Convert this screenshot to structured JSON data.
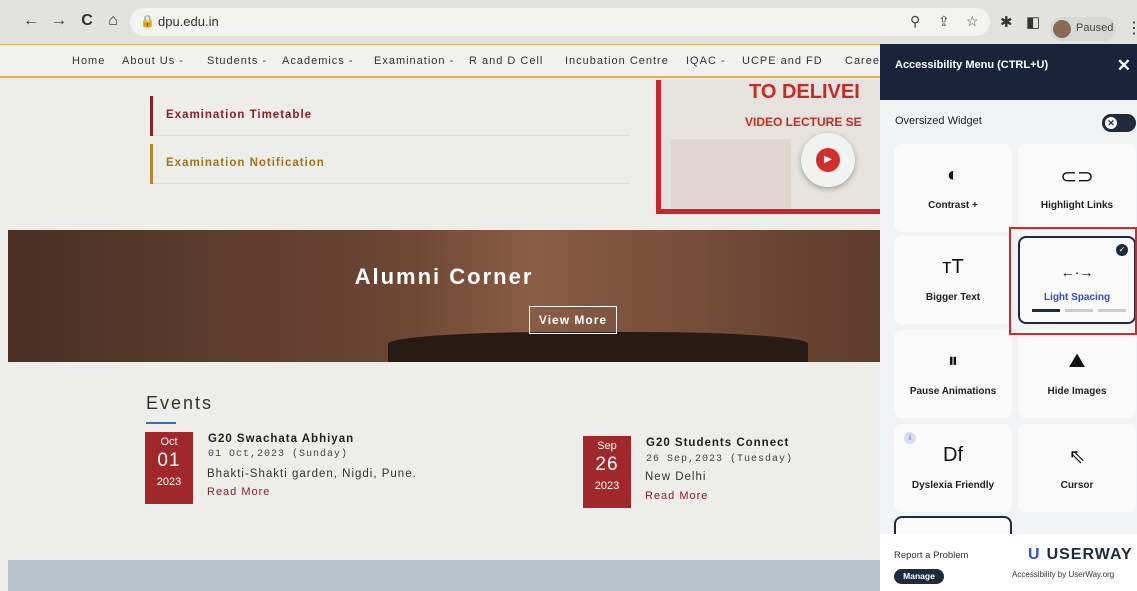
{
  "browser": {
    "url": "dpu.edu.in",
    "profile_status": "Paused",
    "icons": [
      "back-icon",
      "forward-icon",
      "reload-icon",
      "home-icon",
      "lock-icon",
      "search-icon",
      "share-icon",
      "star-icon",
      "extensions-icon",
      "sidepanel-icon",
      "kebab-icon"
    ],
    "back_glyph": "←",
    "forward_glyph": "→",
    "reload_glyph": "C",
    "home_glyph": "⌂",
    "lock_glyph": "🔒",
    "zoom_glyph": "⚲",
    "share_glyph": "⇪",
    "star_glyph": "☆",
    "ext_glyph": "✱",
    "panel_glyph": "◧",
    "kebab_glyph": "⋮"
  },
  "nav": {
    "items": [
      "Home",
      "About Us -",
      "Students -",
      "Academics -",
      "Examination -",
      "R and D Cell",
      "Incubation Centre",
      "IQAC -",
      "UCPE and FD",
      "Caree"
    ]
  },
  "exam_links": [
    {
      "label": "Examination Timetable",
      "color": "#8c1f23"
    },
    {
      "label": "Examination Notification",
      "color": "#a37418"
    }
  ],
  "video": {
    "line1": "TO DELIVEI",
    "line2": "VIDEO LECTURE SE",
    "play_glyph": "▶"
  },
  "alumni": {
    "title": "Alumni Corner",
    "button": "View More"
  },
  "events": {
    "heading": "Events",
    "items": [
      {
        "month": "Oct",
        "day": "01",
        "year": "2023",
        "title": "G20 Swachata Abhiyan",
        "date": "01 Oct,2023 (Sunday)",
        "place": "Bhakti-Shakti garden, Nigdi, Pune.",
        "more": "Read More"
      },
      {
        "month": "Sep",
        "day": "26",
        "year": "2023",
        "title": "G20 Students Connect",
        "date": "26 Sep,2023 (Tuesday)",
        "place": "New Delhi",
        "more": "Read More"
      }
    ]
  },
  "accessibility": {
    "title": "Accessibility Menu (CTRL+U)",
    "close": "✕",
    "oversized_label": "Oversized Widget",
    "toggle_glyph": "✕",
    "tiles": [
      {
        "label": "Contrast +",
        "icon": "◐"
      },
      {
        "label": "Highlight Links",
        "icon": "⊂⊃"
      },
      {
        "label": "Bigger Text",
        "icon": "тT"
      },
      {
        "label": "Light Spacing",
        "icon": "←·→",
        "selected": true
      },
      {
        "label": "Pause Animations",
        "icon": "⏸"
      },
      {
        "label": "Hide Images",
        "icon": "⛰"
      },
      {
        "label": "Dyslexia Friendly",
        "icon": "Df"
      },
      {
        "label": "Cursor",
        "icon": "⇖"
      }
    ],
    "check_glyph": "✓",
    "info_glyph": "i",
    "report": "Report a Problem",
    "manage": "Manage",
    "brand": "USERWAY",
    "brand_mark": "U",
    "brand_sub": "Accessibility by UserWay.org",
    "accent": "#1f2a3d"
  }
}
